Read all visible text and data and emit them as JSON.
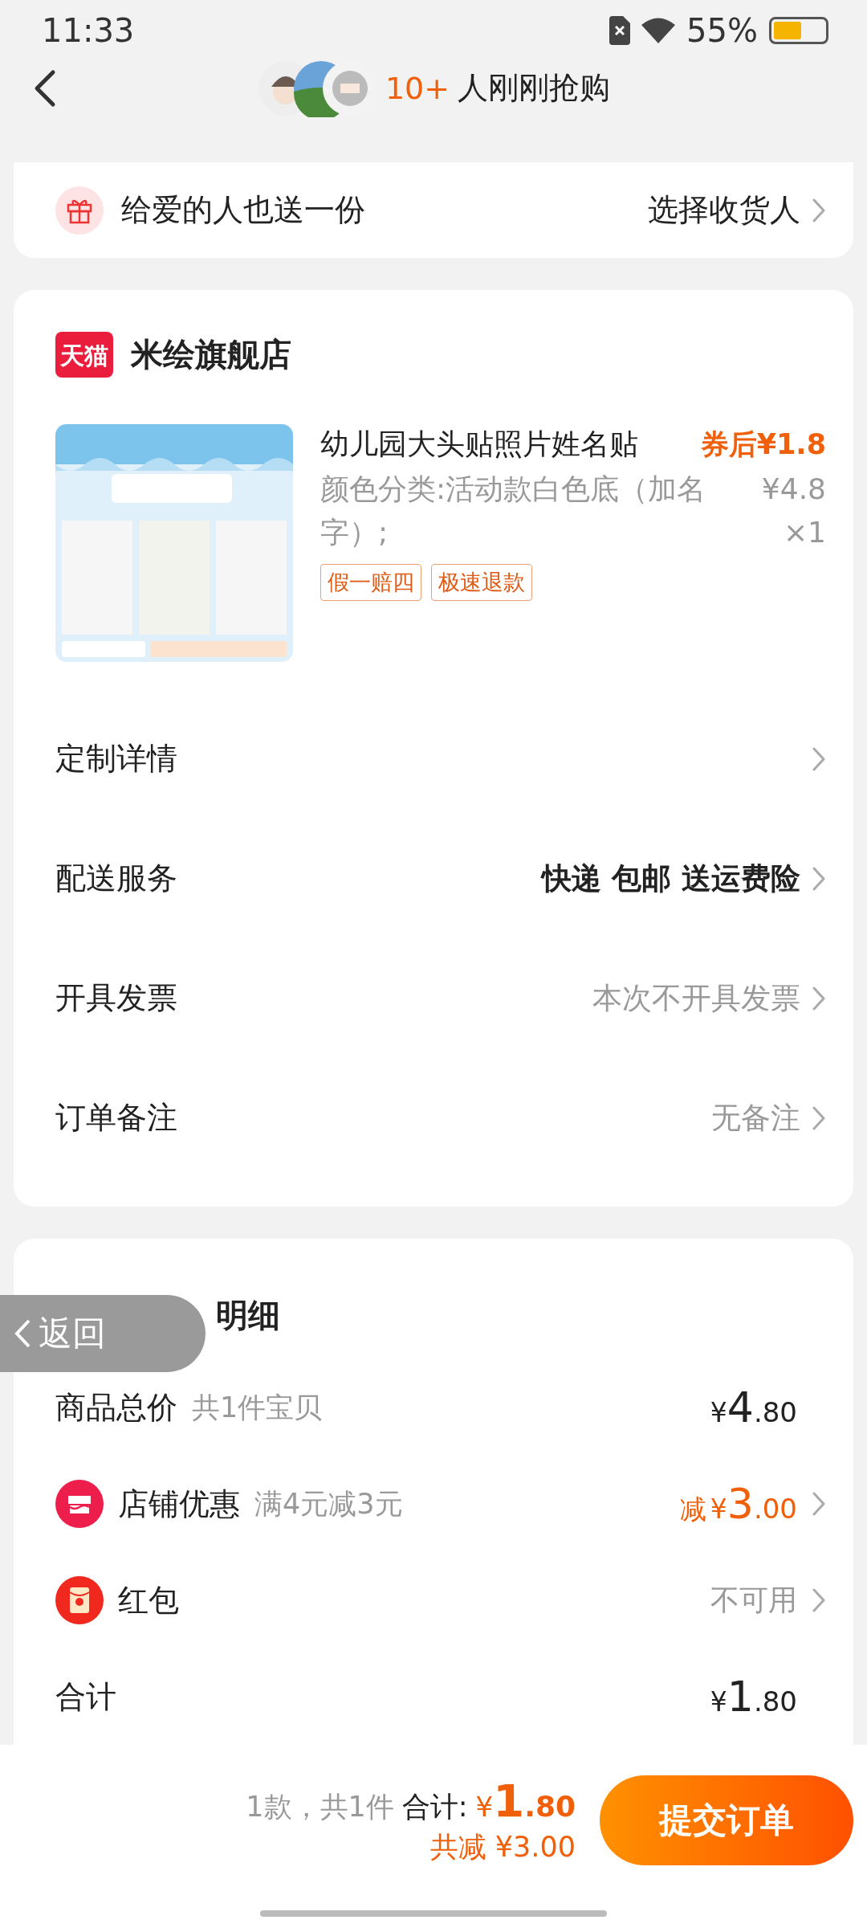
{
  "status_bar": {
    "time": "11:33",
    "battery": "55%"
  },
  "header": {
    "count": "10+",
    "text": "人刚刚抢购"
  },
  "gift_row": {
    "label": "给爱的人也送一份",
    "action": "选择收货人"
  },
  "store": {
    "badge": "天猫",
    "name": "米绘旗舰店"
  },
  "product": {
    "title": "幼儿园大头贴照片姓名贴",
    "variant": "颜色分类:活动款白色底（加名字）;",
    "coupon_price": "券后¥1.8",
    "price": "¥4.8",
    "quantity": "×1",
    "tags": [
      "假一赔四",
      "极速退款"
    ]
  },
  "order_rows": [
    {
      "label": "定制详情"
    },
    {
      "label": "配送服务",
      "value": "快递 包邮 送运费险",
      "emphasis": true
    },
    {
      "label": "开具发票",
      "value": "本次不开具发票",
      "emphasis": false
    },
    {
      "label": "订单备注",
      "value": "无备注",
      "emphasis": false
    }
  ],
  "price_details": {
    "title": "明细",
    "rows": [
      {
        "kind": "plain",
        "label": "商品总价",
        "note": "共1件宝贝",
        "amount": {
          "currency": "¥",
          "integer": "4",
          "decimals": ".80"
        },
        "discount": false,
        "chevron": false
      },
      {
        "kind": "shop",
        "label": "店铺优惠",
        "note": "满4元减3元",
        "amount": {
          "prefix": "减",
          "currency": "¥",
          "integer": "3",
          "decimals": ".00"
        },
        "discount": true,
        "chevron": true
      },
      {
        "kind": "red_packet",
        "label": "红包",
        "value": "不可用",
        "chevron": true
      },
      {
        "kind": "plain",
        "label": "合计",
        "amount": {
          "currency": "¥",
          "integer": "1",
          "decimals": ".80"
        },
        "discount": false,
        "chevron": false
      }
    ]
  },
  "back_overlay": {
    "label": "返回"
  },
  "bottom_bar": {
    "count": "1款，共1件",
    "total_label": "合计:",
    "currency": "¥",
    "integer": "1",
    "decimals": ".80",
    "saving": "共减 ¥3.00",
    "submit": "提交订单"
  }
}
